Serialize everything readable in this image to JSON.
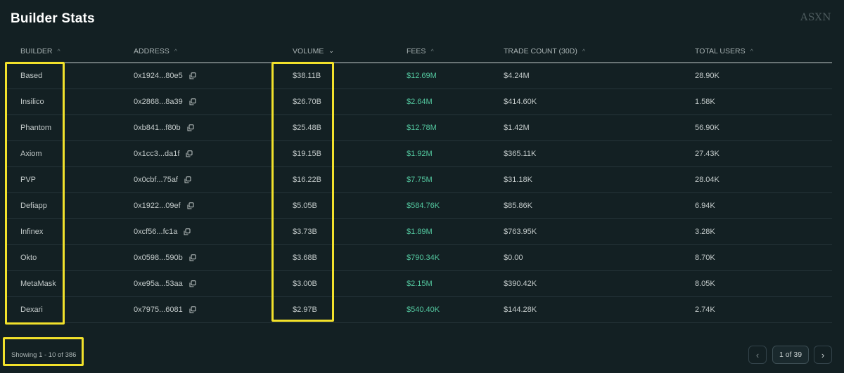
{
  "title": "Builder Stats",
  "watermark": "ASXN",
  "columns": [
    {
      "label": "BUILDER",
      "sort": "asc"
    },
    {
      "label": "ADDRESS",
      "sort": "asc"
    },
    {
      "label": "VOLUME",
      "sort": "desc-active"
    },
    {
      "label": "FEES",
      "sort": "asc"
    },
    {
      "label": "TRADE COUNT (30D)",
      "sort": "asc"
    },
    {
      "label": "TOTAL USERS",
      "sort": "asc"
    }
  ],
  "rows": [
    {
      "builder": "Based",
      "address": "0x1924...80e5",
      "volume": "$38.11B",
      "fees": "$12.69M",
      "trades": "$4.24M",
      "users": "28.90K"
    },
    {
      "builder": "Insilico",
      "address": "0x2868...8a39",
      "volume": "$26.70B",
      "fees": "$2.64M",
      "trades": "$414.60K",
      "users": "1.58K"
    },
    {
      "builder": "Phantom",
      "address": "0xb841...f80b",
      "volume": "$25.48B",
      "fees": "$12.78M",
      "trades": "$1.42M",
      "users": "56.90K"
    },
    {
      "builder": "Axiom",
      "address": "0x1cc3...da1f",
      "volume": "$19.15B",
      "fees": "$1.92M",
      "trades": "$365.11K",
      "users": "27.43K"
    },
    {
      "builder": "PVP",
      "address": "0x0cbf...75af",
      "volume": "$16.22B",
      "fees": "$7.75M",
      "trades": "$31.18K",
      "users": "28.04K"
    },
    {
      "builder": "Defiapp",
      "address": "0x1922...09ef",
      "volume": "$5.05B",
      "fees": "$584.76K",
      "trades": "$85.86K",
      "users": "6.94K"
    },
    {
      "builder": "Infinex",
      "address": "0xcf56...fc1a",
      "volume": "$3.73B",
      "fees": "$1.89M",
      "trades": "$763.95K",
      "users": "3.28K"
    },
    {
      "builder": "Okto",
      "address": "0x0598...590b",
      "volume": "$3.68B",
      "fees": "$790.34K",
      "trades": "$0.00",
      "users": "8.70K"
    },
    {
      "builder": "MetaMask",
      "address": "0xe95a...53aa",
      "volume": "$3.00B",
      "fees": "$2.15M",
      "trades": "$390.42K",
      "users": "8.05K"
    },
    {
      "builder": "Dexari",
      "address": "0x7975...6081",
      "volume": "$2.97B",
      "fees": "$540.40K",
      "trades": "$144.28K",
      "users": "2.74K"
    }
  ],
  "footer": {
    "showing": "Showing 1 - 10 of 386",
    "page_indicator": "1 of 39"
  },
  "icons": {
    "copy": "copy-icon",
    "sort_asc": "chevron-up-icon",
    "sort_desc": "chevron-down-icon",
    "prev": "chevron-left-icon",
    "next": "chevron-right-icon"
  },
  "colors": {
    "background": "#132023",
    "fees_green": "#53c79f",
    "highlight_yellow": "#f2e12b"
  }
}
